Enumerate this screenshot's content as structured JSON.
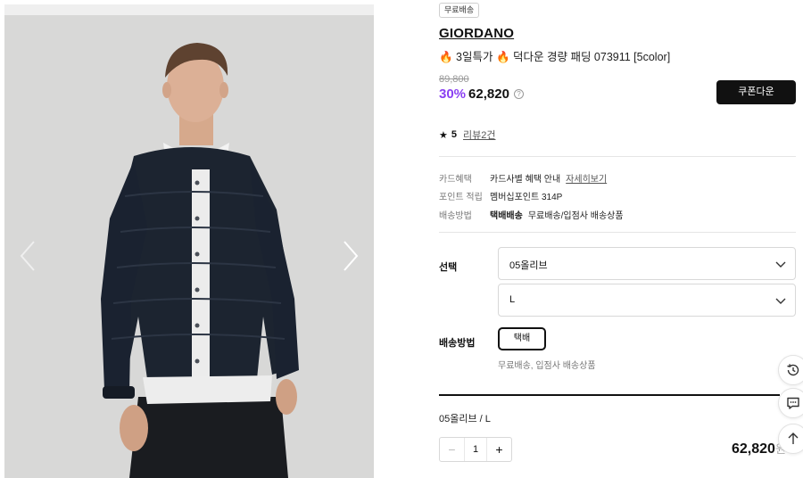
{
  "gallery": {
    "image_name": "model-wearing-navy-down-jacket",
    "prev_icon": "chevron-left-icon",
    "next_icon": "chevron-right-icon"
  },
  "product": {
    "badge": "무료배송",
    "brand": "GIORDANO",
    "title_prefix": "🔥 3일특가 🔥 ",
    "title": "덕다운 경량 패딩 073911 [5color]",
    "original_price": "89,800",
    "discount": "30%",
    "price": "62,820",
    "help_icon_glyph": "?",
    "coupon_button": "쿠폰다운"
  },
  "rating": {
    "score": "5",
    "reviews": "리뷰2건"
  },
  "meta": {
    "card": {
      "label": "카드혜택",
      "value": "카드사별 혜택 안내",
      "link": "자세히보기"
    },
    "point": {
      "label": "포인트 적립",
      "value": "멤버십포인트 314P"
    },
    "shipping": {
      "label": "배송방법",
      "method": "택배배송",
      "value": "무료배송/입점사 배송상품"
    }
  },
  "options": {
    "select_label": "선택",
    "color_value": "05올리브",
    "size_value": "L",
    "shipping_label": "배송방법",
    "shipping_button": "택배",
    "shipping_note": "무료배송, 입점사 배송상품"
  },
  "selection": {
    "summary": "05올리브 / L",
    "quantity": "1",
    "minus": "−",
    "plus": "+",
    "total": "62,820",
    "total_unit": "원"
  },
  "colors": {
    "accent": "#8a3ff2",
    "dark": "#111111",
    "muted": "#777777"
  },
  "float_buttons": [
    "history-icon",
    "chat-icon",
    "scroll-top-icon"
  ]
}
